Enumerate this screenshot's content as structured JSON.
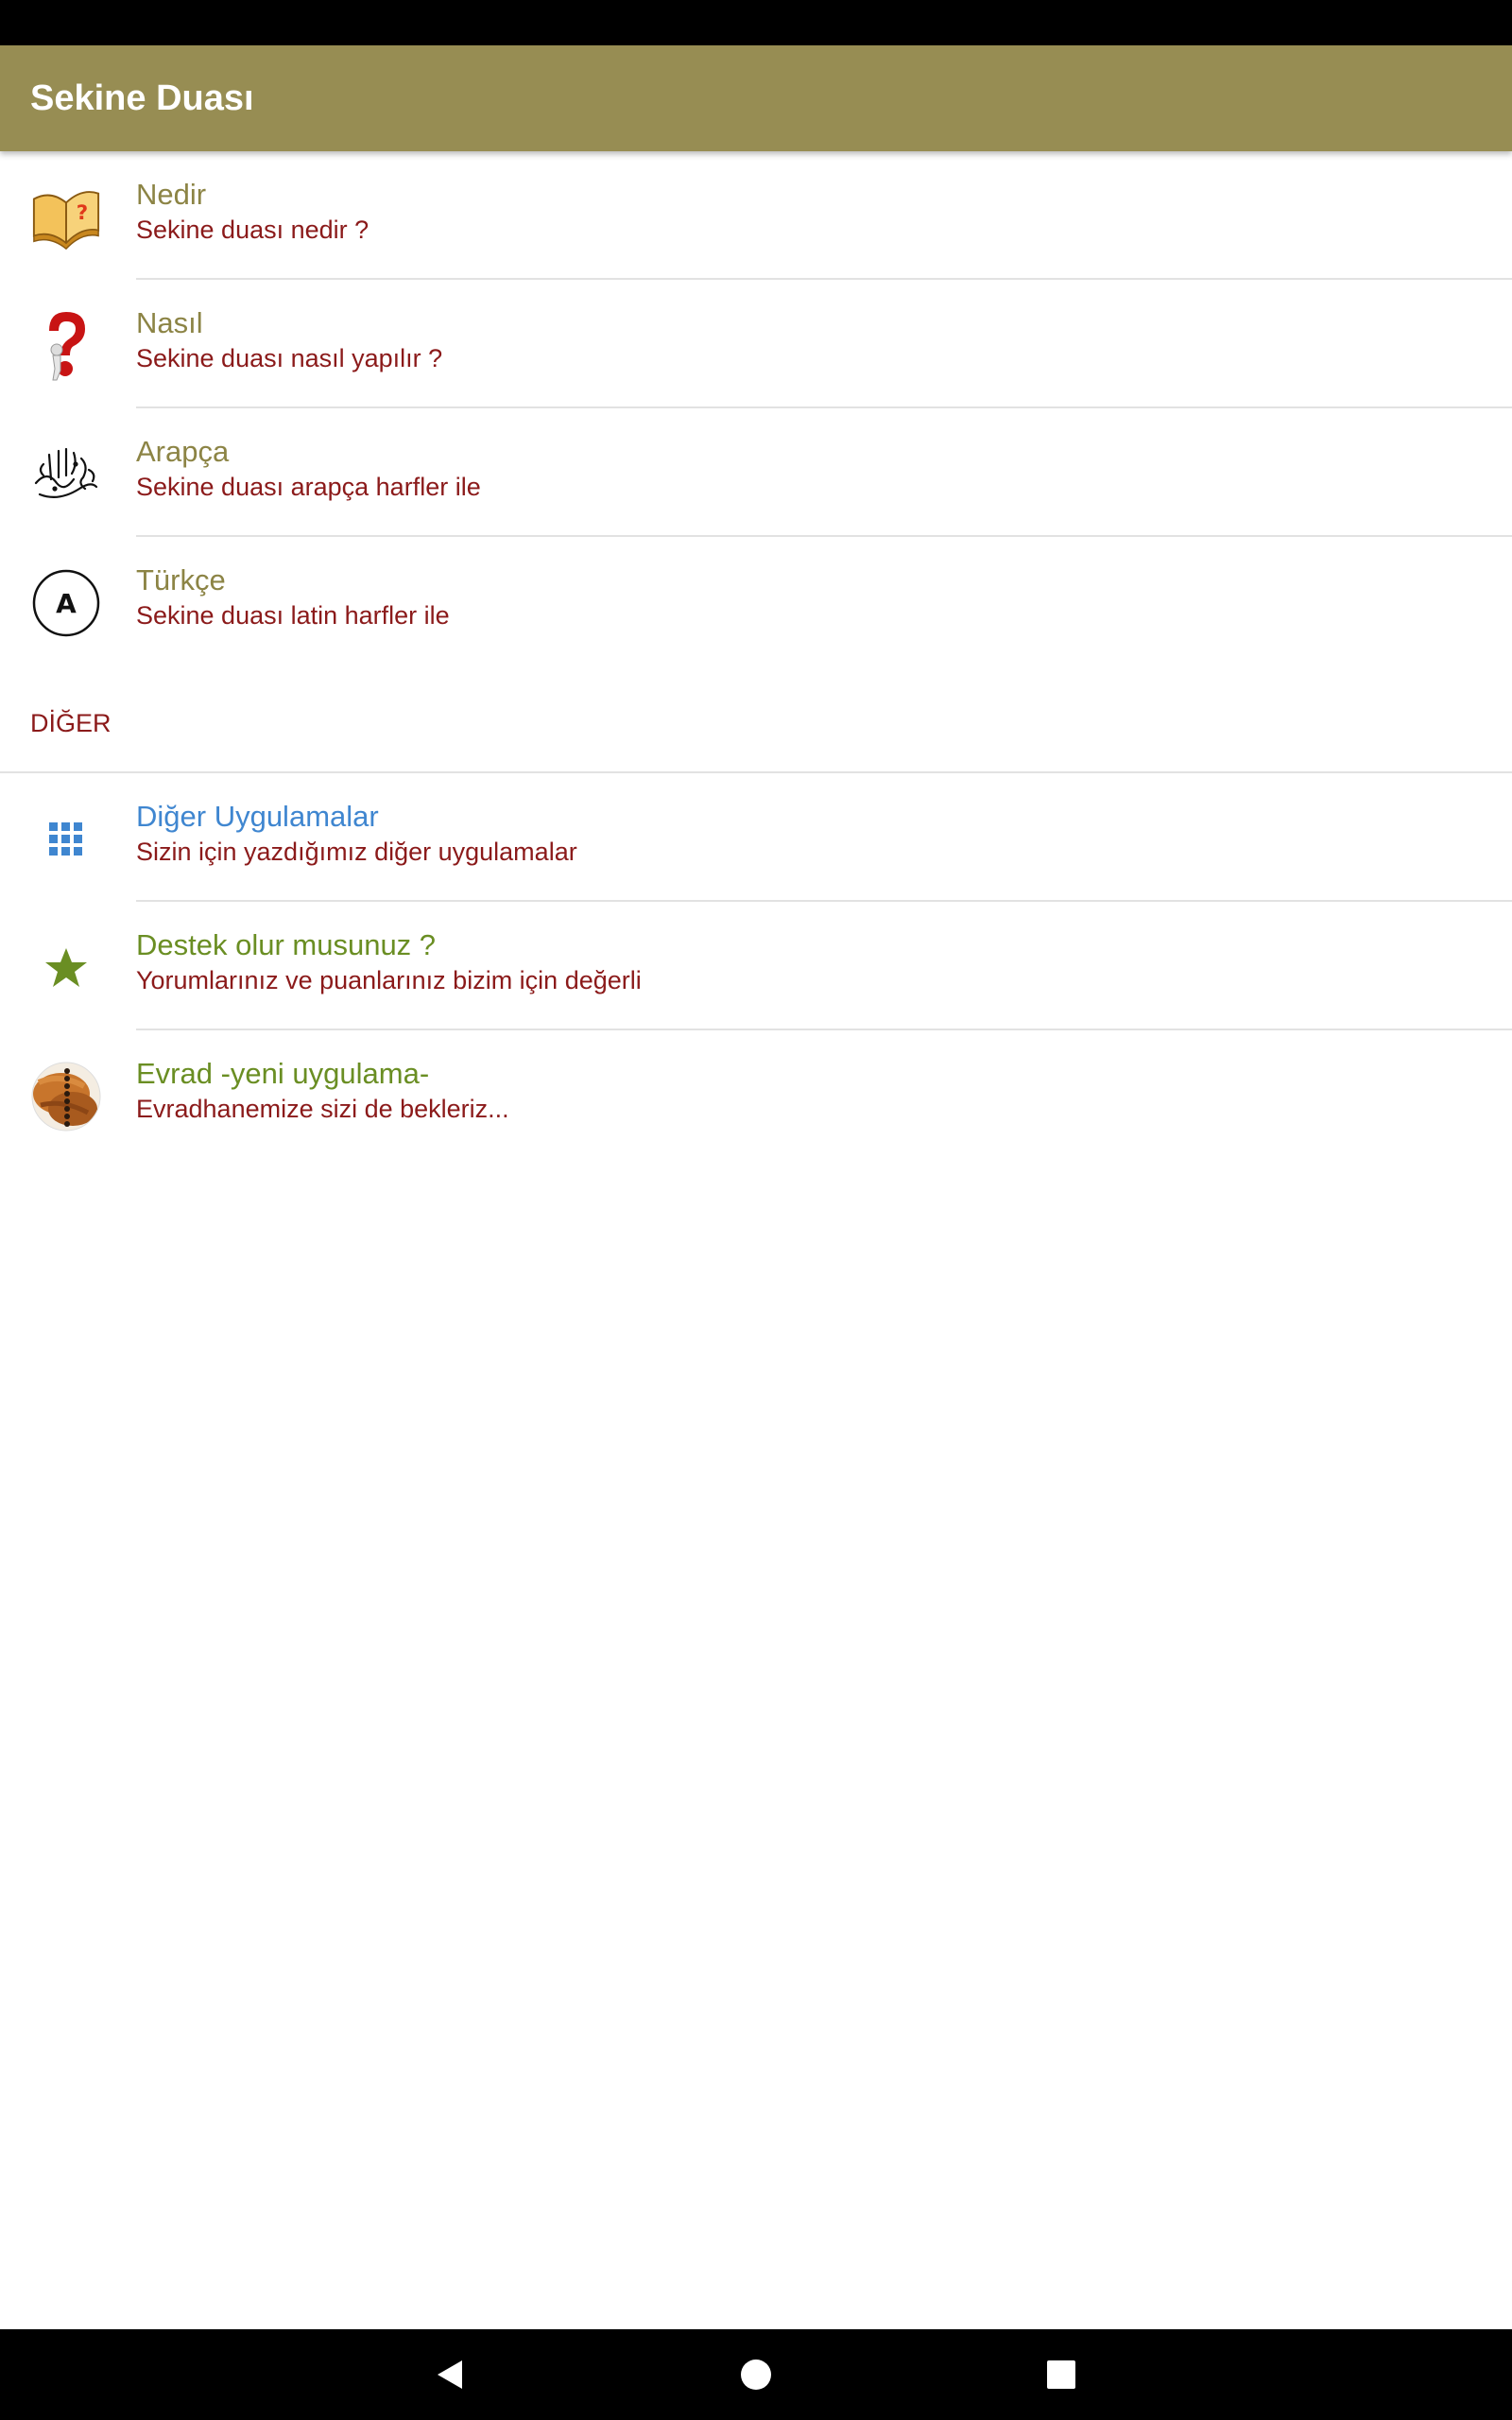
{
  "app": {
    "title": "Sekine Duası",
    "header_color": "#978d53",
    "title_color": "#8c8445",
    "subtitle_color": "#8b1a1a"
  },
  "items": [
    {
      "title": "Nedir",
      "subtitle": "Sekine duası nedir ?",
      "icon": "open-book-question-icon"
    },
    {
      "title": "Nasıl",
      "subtitle": "Sekine duası nasıl yapılır ?",
      "icon": "question-mark-figure-icon"
    },
    {
      "title": "Arapça",
      "subtitle": "Sekine duası arapça harfler ile",
      "icon": "arabic-calligraphy-icon"
    },
    {
      "title": "Türkçe",
      "subtitle": "Sekine duası latin harfler ile",
      "icon": "letter-a-circle-icon"
    }
  ],
  "other": {
    "header": "DİĞER",
    "items": [
      {
        "title": "Diğer Uygulamalar",
        "subtitle": "Sizin için yazdığımız diğer uygulamalar",
        "icon": "apps-grid-icon",
        "title_color": "#3f86d0"
      },
      {
        "title": "Destek olur musunuz ?",
        "subtitle": "Yorumlarınız ve puanlarınız bizim için değerli",
        "icon": "star-icon",
        "title_color": "#6a8e23"
      },
      {
        "title": "Evrad -yeni uygulama-",
        "subtitle": "Evradhanemize sizi de bekleriz...",
        "icon": "prayer-beads-icon",
        "title_color": "#6a8e23"
      }
    ]
  },
  "nav": {
    "back": "back-icon",
    "home": "home-icon",
    "recents": "recents-icon"
  }
}
